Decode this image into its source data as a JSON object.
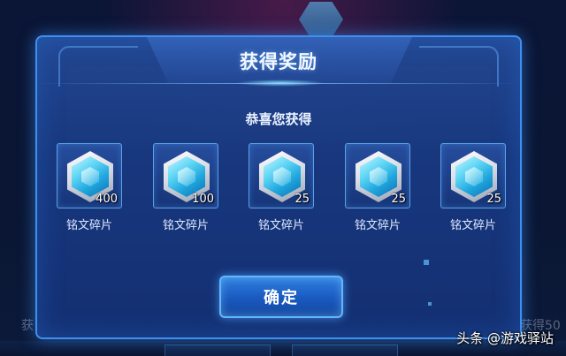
{
  "modal": {
    "title": "获得奖励",
    "subtitle": "恭喜您获得",
    "confirm_label": "确定"
  },
  "rewards": [
    {
      "name": "铭文碎片",
      "quantity": "400",
      "icon": "inscription-gem-icon"
    },
    {
      "name": "铭文碎片",
      "quantity": "100",
      "icon": "inscription-gem-icon"
    },
    {
      "name": "铭文碎片",
      "quantity": "25",
      "icon": "inscription-gem-icon"
    },
    {
      "name": "铭文碎片",
      "quantity": "25",
      "icon": "inscription-gem-icon"
    },
    {
      "name": "铭文碎片",
      "quantity": "25",
      "icon": "inscription-gem-icon"
    }
  ],
  "background": {
    "left_text": "获",
    "right_text": "获得50"
  },
  "watermark": "头条 @游戏驿站",
  "colors": {
    "panel": "#1e3f8a",
    "border": "#3f8ff0",
    "button": "#1a59bf"
  }
}
